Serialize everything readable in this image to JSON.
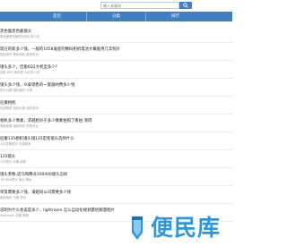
{
  "search": {
    "placeholder": "输入关键词"
  },
  "nav": {
    "items": [
      "首页",
      "分类",
      "排行"
    ]
  },
  "feed": {
    "items": [
      {
        "title": "黑色鹿黑色鹿镜头",
        "meta": "黑色鹿黑色鹿镜头照片多少钱"
      },
      {
        "title": "现在的新多少钱，一般的1058毫星的数码相机电池大概能用几年照片",
        "meta": "相机资讯 数码相机 数码知识"
      },
      {
        "title": "镜头多少，佳能6D2大机型多少?",
        "meta": "佳能 6D2 新机型 大约多少钱"
      },
      {
        "title": "镜头多少钱，众泰销售的一套器材费多少钱",
        "meta": "镜头价格 相机器材 众泰"
      },
      {
        "title": "尼康相机",
        "meta": "尼康相机 相机价格 相机资讯"
      },
      {
        "title": "相机多少像素，求越相对于多少像素拍照了看拍 测得",
        "meta": "像素参数 相机测评 拍照对比"
      },
      {
        "title": "尼康135相机镜头镜135定焦镜头选择什么",
        "meta": "135定焦镜头 尼康相机"
      },
      {
        "title": "135镜头",
        "meta": "135镜头 价格 参数"
      },
      {
        "title": "镜头参数,适马和腾龙100400镜头怎样",
        "meta": "100400镜头 适马 腾龙"
      },
      {
        "title": "单反需要多少钱，请越同公司需要多少钱",
        "meta": "单反相机 价格 购买"
      },
      {
        "title": "说明为什么会说是多少，lightroom 怎么自动化规划量给赖量图片",
        "meta": "lightroom 后期 教程"
      }
    ]
  },
  "watermark": {
    "text": "便民库"
  },
  "colors": {
    "accent": "#3f7fc4",
    "watermark": "#2f95dd"
  }
}
